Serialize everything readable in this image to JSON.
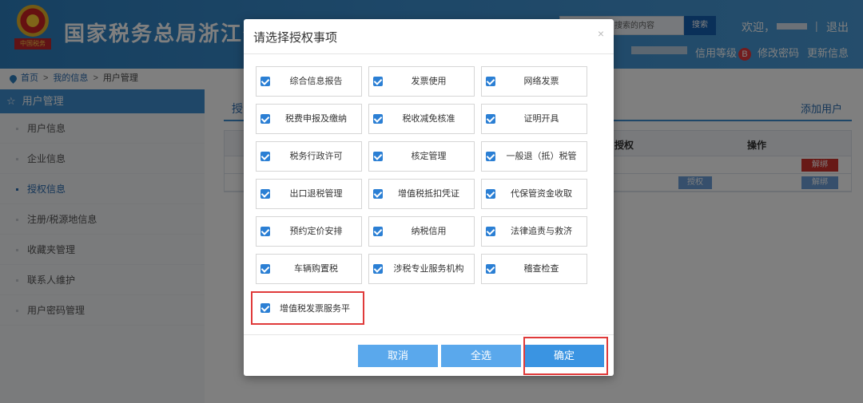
{
  "header": {
    "site_title": "国家税务总局浙江省电",
    "emblem_text": "中国税务",
    "search_placeholder": "搜索的内容",
    "search_button": "搜索",
    "welcome": "欢迎，",
    "separator": "|",
    "logout": "退出",
    "credit_level": "信用等级",
    "credit_badge": "B",
    "change_password": "修改密码",
    "update_info": "更新信息"
  },
  "breadcrumb": {
    "home": "首页",
    "sep": ">",
    "my_info": "我的信息",
    "current": "用户管理"
  },
  "sidebar": {
    "title": "用户管理",
    "items": [
      {
        "label": "用户信息"
      },
      {
        "label": "企业信息"
      },
      {
        "label": "授权信息"
      },
      {
        "label": "注册/税源地信息"
      },
      {
        "label": "收藏夹管理"
      },
      {
        "label": "联系人维护"
      },
      {
        "label": "用户密码管理"
      }
    ]
  },
  "main": {
    "tab_label": "授",
    "add_user": "添加用户",
    "col_auth": "授权",
    "col_op": "操作",
    "row1_unbind": "解绑",
    "row2_auth": "授权",
    "row2_unbind": "解绑"
  },
  "modal": {
    "title": "请选择授权事项",
    "close": "×",
    "items": [
      {
        "label": "综合信息报告",
        "checked": true
      },
      {
        "label": "发票使用",
        "checked": true
      },
      {
        "label": "网络发票",
        "checked": true
      },
      {
        "label": "税费申报及缴纳",
        "checked": true
      },
      {
        "label": "税收减免核准",
        "checked": true
      },
      {
        "label": "证明开具",
        "checked": true
      },
      {
        "label": "税务行政许可",
        "checked": true
      },
      {
        "label": "核定管理",
        "checked": true
      },
      {
        "label": "一般退（抵）税管",
        "checked": true
      },
      {
        "label": "出口退税管理",
        "checked": true
      },
      {
        "label": "增值税抵扣凭证",
        "checked": true
      },
      {
        "label": "代保管资金收取",
        "checked": true
      },
      {
        "label": "预约定价安排",
        "checked": true
      },
      {
        "label": "纳税信用",
        "checked": true
      },
      {
        "label": "法律追责与救济",
        "checked": true
      },
      {
        "label": "车辆购置税",
        "checked": true
      },
      {
        "label": "涉税专业服务机构",
        "checked": true
      },
      {
        "label": "稽查检查",
        "checked": true
      },
      {
        "label": "增值税发票服务平",
        "checked": true
      }
    ],
    "cancel": "取消",
    "select_all": "全选",
    "confirm": "确定"
  }
}
